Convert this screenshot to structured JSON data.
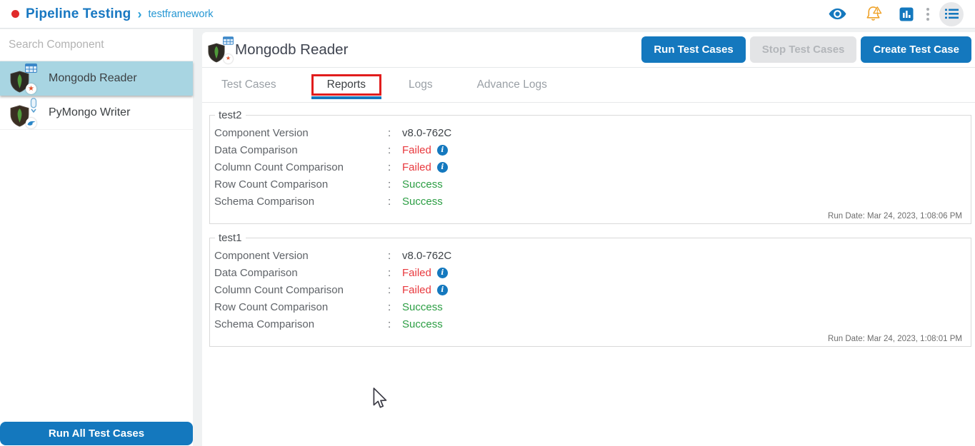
{
  "header": {
    "app_title": "Pipeline Testing",
    "breadcrumb_separator": "›",
    "breadcrumb": "testframework",
    "icon_names": [
      "eye",
      "notification-bell",
      "analytics-chart",
      "more-options",
      "menu-list"
    ]
  },
  "sidebar": {
    "search_placeholder": "Search Component",
    "components": [
      {
        "name": "Mongodb Reader",
        "selected": true
      },
      {
        "name": "PyMongo Writer",
        "selected": false
      }
    ],
    "run_all_label": "Run All Test Cases"
  },
  "main": {
    "title": "Mongodb Reader",
    "buttons": {
      "run": "Run Test Cases",
      "stop": "Stop Test Cases",
      "create": "Create Test Case"
    },
    "tabs": [
      {
        "label": "Test Cases",
        "active": false
      },
      {
        "label": "Reports",
        "active": true
      },
      {
        "label": "Logs",
        "active": false
      },
      {
        "label": "Advance Logs",
        "active": false
      }
    ],
    "reports": [
      {
        "name": "test2",
        "rows": [
          {
            "label": "Component Version",
            "value": "v8.0-762C",
            "status": "plain",
            "info": false
          },
          {
            "label": "Data Comparison",
            "value": "Failed",
            "status": "failed",
            "info": true
          },
          {
            "label": "Column Count Comparison",
            "value": "Failed",
            "status": "failed",
            "info": true
          },
          {
            "label": "Row Count Comparison",
            "value": "Success",
            "status": "success",
            "info": false
          },
          {
            "label": "Schema Comparison",
            "value": "Success",
            "status": "success",
            "info": false
          }
        ],
        "run_date": "Run Date: Mar 24, 2023, 1:08:06 PM"
      },
      {
        "name": "test1",
        "rows": [
          {
            "label": "Component Version",
            "value": "v8.0-762C",
            "status": "plain",
            "info": false
          },
          {
            "label": "Data Comparison",
            "value": "Failed",
            "status": "failed",
            "info": true
          },
          {
            "label": "Column Count Comparison",
            "value": "Failed",
            "status": "failed",
            "info": true
          },
          {
            "label": "Row Count Comparison",
            "value": "Success",
            "status": "success",
            "info": false
          },
          {
            "label": "Schema Comparison",
            "value": "Success",
            "status": "success",
            "info": false
          }
        ],
        "run_date": "Run Date: Mar 24, 2023, 1:08:01 PM"
      }
    ]
  },
  "ui": {
    "colon": ":",
    "info_glyph": "i",
    "star_badge_glyph": "★"
  },
  "colors": {
    "accent_blue": "#1478be",
    "failed_red": "#e8383d",
    "success_green": "#2c9e44",
    "selected_item_bg": "#a8d5e2",
    "annotation_red": "#e11d1d",
    "bell_orange": "#efa32b"
  }
}
